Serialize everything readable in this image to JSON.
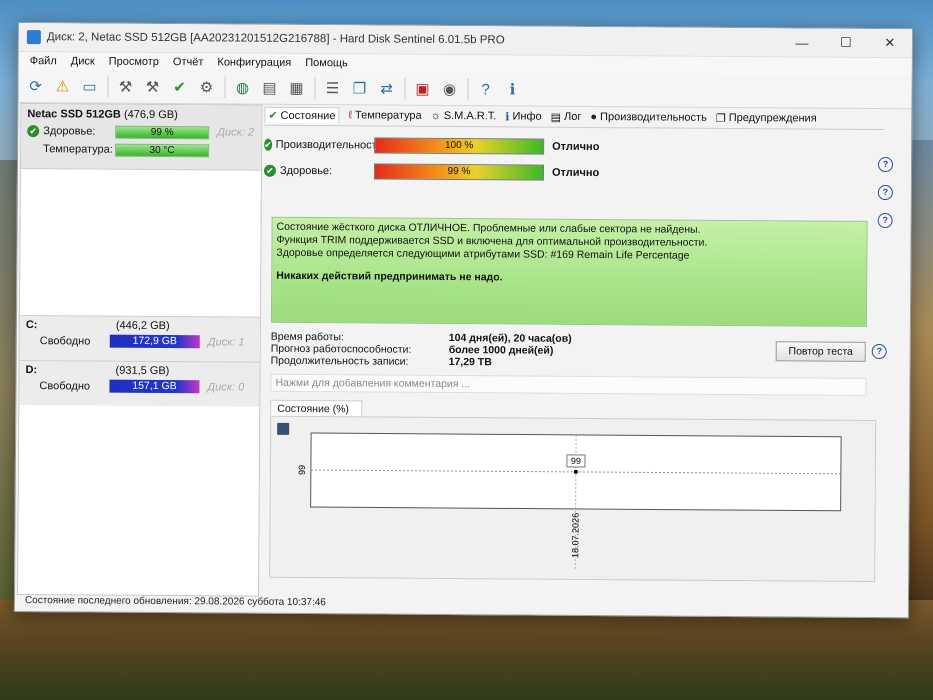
{
  "window": {
    "title": "Диск: 2, Netac SSD 512GB [AA20231201512G216788]  -  Hard Disk Sentinel 6.01.5b PRO",
    "controls": [
      "—",
      "☐",
      "✕"
    ]
  },
  "menu": [
    "Файл",
    "Диск",
    "Просмотр",
    "Отчёт",
    "Конфигурация",
    "Помощь"
  ],
  "sidebar": {
    "disk_name": "Netac SSD 512GB",
    "disk_size": "(476,9 GB)",
    "health_label": "Здоровье:",
    "health_value": "99 %",
    "disk_index": "Диск: 2",
    "temp_label": "Температура:",
    "temp_value": "30 °C",
    "partitions": [
      {
        "letter": "C:",
        "size": "(446,2 GB)",
        "free_label": "Свободно",
        "free_value": "172,9 GB",
        "disk": "Диск: 1"
      },
      {
        "letter": "D:",
        "size": "(931,5 GB)",
        "free_label": "Свободно",
        "free_value": "157,1 GB",
        "disk": "Диск: 0"
      }
    ]
  },
  "tabs": [
    "Состояние",
    "Температура",
    "S.M.A.R.T.",
    "Инфо",
    "Лог",
    "Производительность",
    "Предупреждения"
  ],
  "metrics": {
    "performance": {
      "label": "Производительность:",
      "value": "100 %",
      "status": "Отлично"
    },
    "health": {
      "label": "Здоровье:",
      "value": "99 %",
      "status": "Отлично"
    }
  },
  "status_text": {
    "line1": "Состояние жёсткого диска ОТЛИЧНОЕ. Проблемные или слабые сектора не найдены.",
    "line2": "Функция TRIM поддерживается SSD и включена для оптимальной производительности.",
    "line3": "Здоровье определяется следующими атрибутами SSD: #169 Remain Life Percentage",
    "line4": "Никаких действий предпринимать не надо."
  },
  "info": {
    "uptime_label": "Время работы:",
    "uptime_value": "104 дня(ей), 20 часа(ов)",
    "forecast_label": "Прогноз работоспособности:",
    "forecast_value": "более 1000 дней(ей)",
    "writes_label": "Продолжительность записи:",
    "writes_value": "17,29 TB"
  },
  "retest_button": "Повтор теста",
  "comment_placeholder": "Нажми для добавления комментария ...",
  "chart_tab_label": "Состояние (%)",
  "chart_data": {
    "type": "line",
    "x": [
      "18.07.2026"
    ],
    "series": [
      {
        "values": [
          99
        ]
      }
    ],
    "ylabel_tick": "99",
    "data_label": "99"
  },
  "statusbar": "Состояние последнего обновления: 29.08.2026 суббота 10:37:46"
}
